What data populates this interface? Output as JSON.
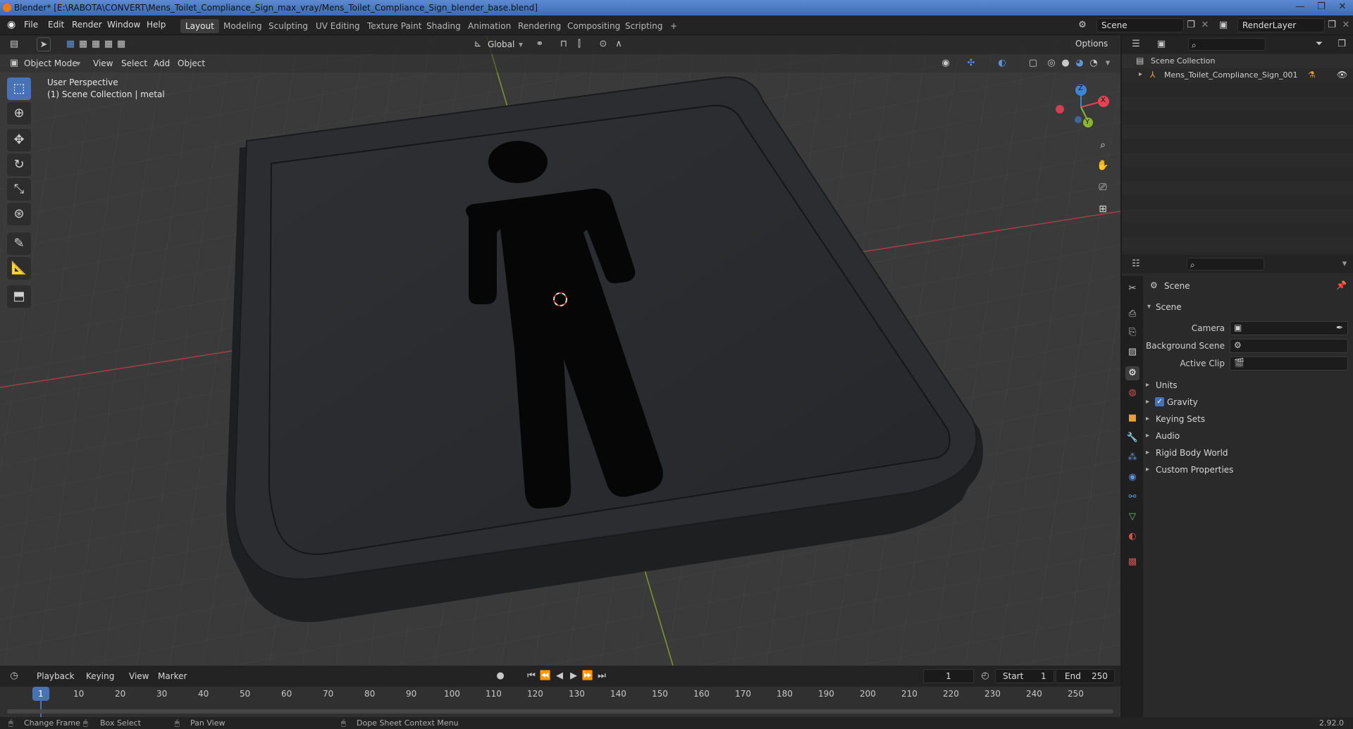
{
  "window": {
    "title": "Blender* [E:\\RABOTA\\CONVERT\\Mens_Toilet_Compliance_Sign_max_vray/Mens_Toilet_Compliance_Sign_blender_base.blend]",
    "minimize": "—",
    "maximize": "❐",
    "close": "✕"
  },
  "menu": {
    "items": [
      "File",
      "Edit",
      "Render",
      "Window",
      "Help"
    ]
  },
  "workspaces": {
    "tabs": [
      "Layout",
      "Modeling",
      "Sculpting",
      "UV Editing",
      "Texture Paint",
      "Shading",
      "Animation",
      "Rendering",
      "Compositing",
      "Scripting"
    ],
    "add": "+",
    "active": "Layout"
  },
  "scene_selector": {
    "value": "Scene"
  },
  "renderlayer_selector": {
    "value": "RenderLayer"
  },
  "viewport": {
    "mode": "Object Mode",
    "menus": [
      "View",
      "Select",
      "Add",
      "Object"
    ],
    "transform_orientation": "Global",
    "options_label": "Options",
    "overlay_line1": "User Perspective",
    "overlay_line2": "(1) Scene Collection | metal",
    "gizmo": {
      "x": "X",
      "y": "Y",
      "z": "Z"
    },
    "colors": {
      "x_axis": "#e04455",
      "y_axis": "#8ab52d",
      "z_axis": "#3d86d6",
      "background": "#3a3a3a",
      "grid": "#444444"
    },
    "tools": [
      "select-box-icon",
      "cursor-icon",
      "move-icon",
      "rotate-icon",
      "scale-icon",
      "transform-icon",
      "annotate-icon",
      "measure-icon",
      "add-cube-icon"
    ],
    "nav": [
      "zoom-icon",
      "pan-hand-icon",
      "camera-icon",
      "grid-ortho-icon"
    ]
  },
  "outliner": {
    "root": "Scene Collection",
    "items": [
      {
        "label": "Mens_Toilet_Compliance_Sign_001"
      }
    ]
  },
  "properties": {
    "breadcrumb": "Scene",
    "section": "Scene",
    "fields": [
      {
        "label": "Camera",
        "value": ""
      },
      {
        "label": "Background Scene",
        "value": ""
      },
      {
        "label": "Active Clip",
        "value": ""
      }
    ],
    "panels": [
      {
        "label": "Units",
        "checkbox": false
      },
      {
        "label": "Gravity",
        "checkbox": true
      },
      {
        "label": "Keying Sets",
        "checkbox": false
      },
      {
        "label": "Audio",
        "checkbox": false
      },
      {
        "label": "Rigid Body World",
        "checkbox": false
      },
      {
        "label": "Custom Properties",
        "checkbox": false
      }
    ]
  },
  "timeline": {
    "menus": [
      "Playback",
      "Keying",
      "View",
      "Marker"
    ],
    "current_frame": "1",
    "start_label": "Start",
    "start": "1",
    "end_label": "End",
    "end": "250",
    "ticks": [
      "1",
      "10",
      "20",
      "30",
      "40",
      "50",
      "60",
      "70",
      "80",
      "90",
      "100",
      "110",
      "120",
      "130",
      "140",
      "150",
      "160",
      "170",
      "180",
      "190",
      "200",
      "210",
      "220",
      "230",
      "240",
      "250"
    ]
  },
  "statusbar": {
    "items": [
      "Change Frame",
      "Box Select",
      "Pan View",
      "Dope Sheet Context Menu"
    ],
    "version": "2.92.0"
  }
}
